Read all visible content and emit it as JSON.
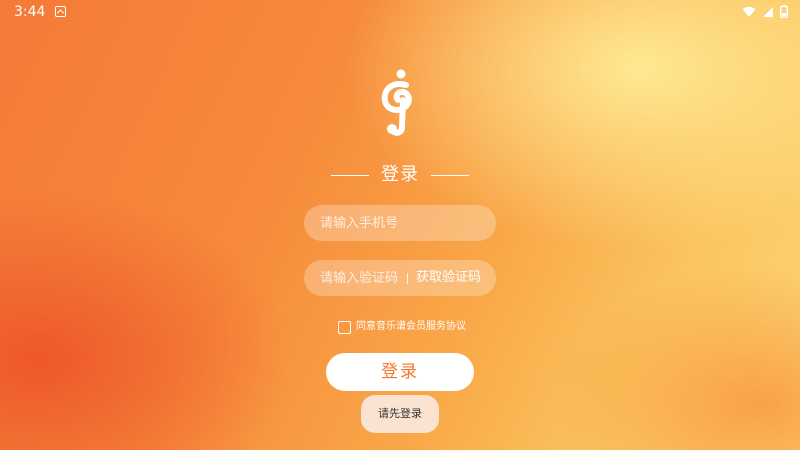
{
  "status_bar": {
    "time": "3:44",
    "icons": [
      "notification-app-icon",
      "wifi-icon",
      "cellular-signal-icon",
      "battery-icon"
    ]
  },
  "logo": {
    "icon": "music-note-logo-icon",
    "color": "#ffffff"
  },
  "login": {
    "title": "登录",
    "phone_placeholder": "请输入手机号",
    "phone_value": "",
    "code_placeholder": "请输入验证码",
    "code_value": "",
    "get_code_label": "获取验证码",
    "agreement_label": "同意音乐谱会员服务协议",
    "agreement_checked": false,
    "login_button": "登录",
    "prelogin_button": "请先登录"
  },
  "colors": {
    "accent": "#f4782e",
    "background_start": "#f47a38",
    "background_end": "#fcd777",
    "text_light": "#ffffff"
  }
}
